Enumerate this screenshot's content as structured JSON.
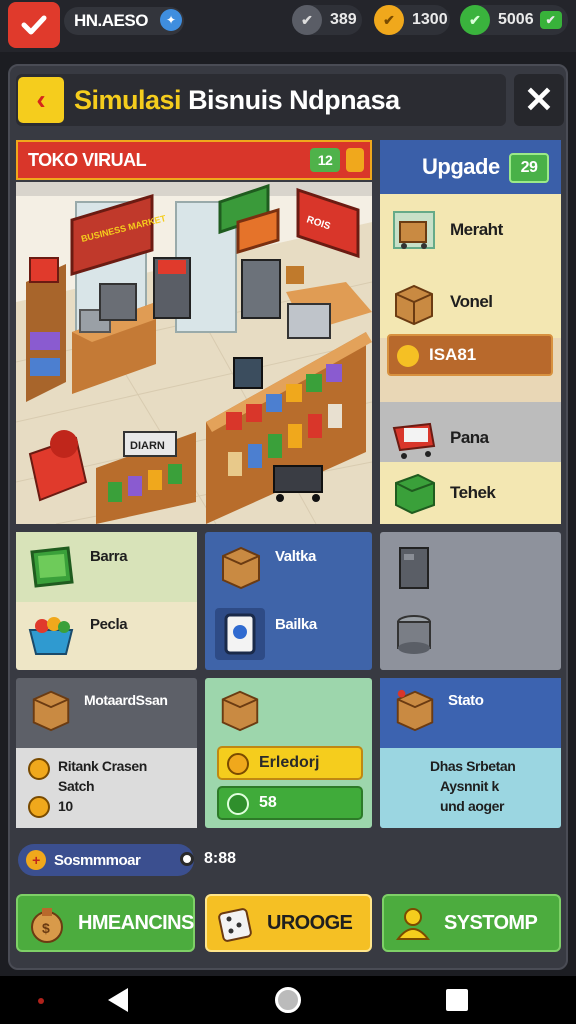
{
  "status_bar": {
    "player_name": "HN.AESO",
    "resource_silver": "389",
    "resource_gold": "1300",
    "resource_gems": "5006"
  },
  "header": {
    "title_word1": "Simulasi",
    "title_rest": "Bisnuis Ndpnasa"
  },
  "shop": {
    "title": "TOKO VIRUAL",
    "badge": "12",
    "sign_left": "BUSINESS MARKET",
    "sign_mid": "ROIS",
    "sign_shelf": "DIARN"
  },
  "upgrade_panel": {
    "title": "Upgade",
    "badge": "29",
    "items": [
      {
        "label": "Meraht",
        "icon": "cart-box-icon"
      },
      {
        "label": "Vonel",
        "icon": "cardboard-box-icon"
      },
      {
        "label": "Pana",
        "icon": "shopping-cart-icon"
      },
      {
        "label": "Tehek",
        "icon": "green-crate-icon"
      }
    ],
    "price": "ISA81"
  },
  "cards": {
    "c1": {
      "item1": "Barra",
      "item2": "Pecla"
    },
    "c2": {
      "item1": "Valtka",
      "item2": "Bailka"
    },
    "c4": {
      "title": "MotaardSsan",
      "line1": "Ritank Crasen",
      "line2": "Satch",
      "line3": "10"
    },
    "c5": {
      "btn_yellow": "Erledorj",
      "btn_green": "58"
    },
    "c6": {
      "title": "Stato",
      "desc1": "Dhas Srbetan",
      "desc2": "Aysnnit k",
      "desc3": "und aoger"
    }
  },
  "status_row": {
    "label": "Sosmmmoar",
    "timer": "8:88"
  },
  "bottom_buttons": {
    "b1": "HMEANCINS",
    "b2": "UROOGE",
    "b3": "SYSTOMP"
  },
  "colors": {
    "accent_yellow": "#f5cd1d",
    "accent_red": "#d9362a",
    "accent_green": "#4cac3e",
    "accent_blue": "#3a5fa9"
  }
}
